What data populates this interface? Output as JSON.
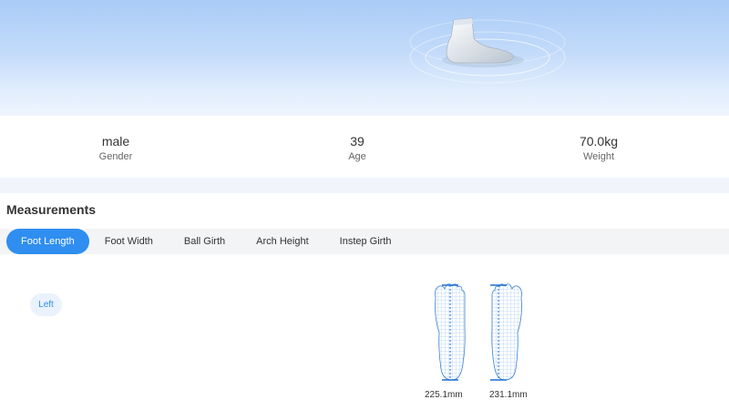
{
  "profile": {
    "gender": {
      "value": "male",
      "label": "Gender"
    },
    "age": {
      "value": "39",
      "label": "Age"
    },
    "weight": {
      "value": "70.0kg",
      "label": "Weight"
    }
  },
  "measurements": {
    "title": "Measurements",
    "tabs": [
      {
        "label": "Foot Length",
        "active": true
      },
      {
        "label": "Foot Width",
        "active": false
      },
      {
        "label": "Ball Girth",
        "active": false
      },
      {
        "label": "Arch Height",
        "active": false
      },
      {
        "label": "Instep Girth",
        "active": false
      }
    ],
    "side_label": "Left",
    "left_value": "225.1mm",
    "right_value": "231.1mm"
  },
  "colors": {
    "accent": "#2f8ef0",
    "hero_top": "#a9cbf7",
    "foot_mesh": "#4a8fe0"
  },
  "icons": {
    "hero": "3d-foot-model-icon",
    "feet": "foot-scan-mesh-icon"
  }
}
